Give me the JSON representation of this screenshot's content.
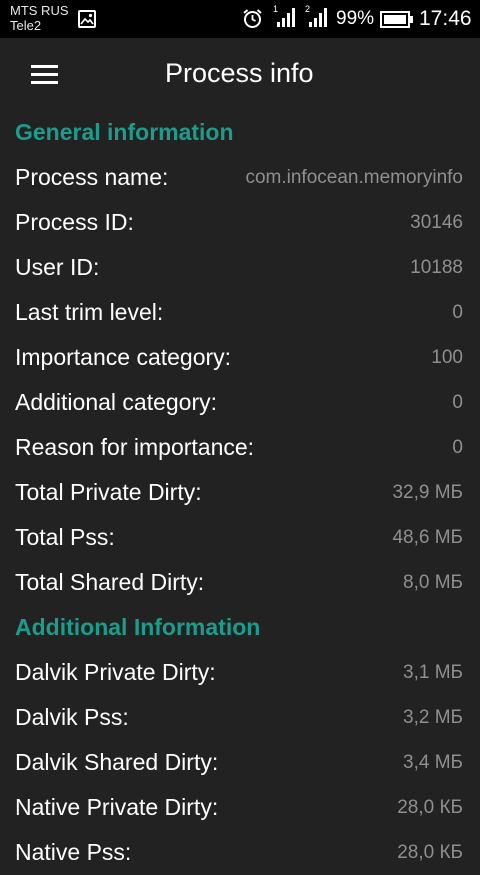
{
  "status_bar": {
    "carrier1": "MTS RUS",
    "carrier2": "Tele2",
    "sim1_label": "1",
    "sim2_label": "2",
    "battery_percent": "99%",
    "time": "17:46",
    "icons": [
      "gallery-icon",
      "alarm-icon",
      "signal-icon",
      "battery-icon"
    ]
  },
  "app_bar": {
    "menu_icon": "menu-icon",
    "title": "Process info"
  },
  "sections": {
    "general": {
      "title": "General information",
      "rows": [
        {
          "label": "Process name:",
          "value": "com.infocean.memoryinfo"
        },
        {
          "label": "Process ID:",
          "value": "30146"
        },
        {
          "label": "User ID:",
          "value": "10188"
        },
        {
          "label": "Last trim level:",
          "value": "0"
        },
        {
          "label": "Importance category:",
          "value": "100"
        },
        {
          "label": "Additional category:",
          "value": "0"
        },
        {
          "label": "Reason for importance:",
          "value": "0"
        },
        {
          "label": "Total Private Dirty:",
          "value": "32,9 МБ"
        },
        {
          "label": "Total Pss:",
          "value": "48,6 МБ"
        },
        {
          "label": "Total Shared Dirty:",
          "value": "8,0 МБ"
        }
      ]
    },
    "additional": {
      "title": "Additional Information",
      "rows": [
        {
          "label": "Dalvik Private Dirty:",
          "value": "3,1 МБ"
        },
        {
          "label": "Dalvik Pss:",
          "value": "3,2 МБ"
        },
        {
          "label": "Dalvik Shared Dirty:",
          "value": "3,4 МБ"
        },
        {
          "label": "Native Private Dirty:",
          "value": "28,0 КБ"
        },
        {
          "label": "Native Pss:",
          "value": "28,0 КБ"
        }
      ]
    }
  },
  "colors": {
    "accent": "#1c9c8c",
    "background": "#222222",
    "status_bar": "#000000",
    "label_text": "#ffffff",
    "value_text": "#8f8f8f"
  }
}
